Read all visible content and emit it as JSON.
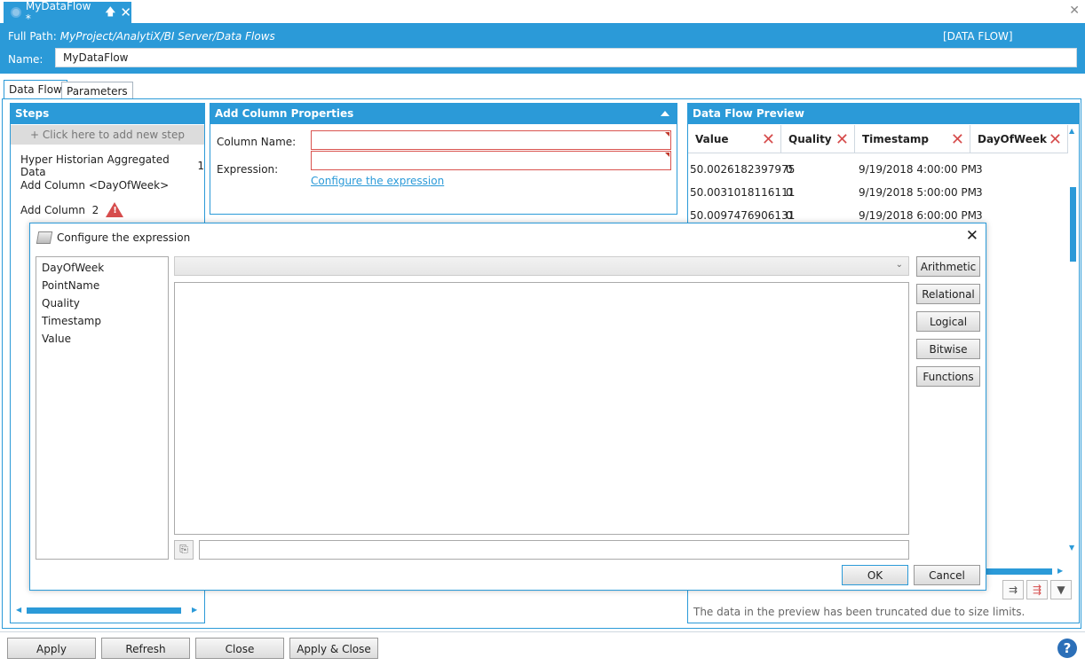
{
  "window": {
    "tab_title": "MyDataFlow *",
    "pin_glyph": "🡅",
    "close_glyph": "✕",
    "window_close_glyph": "✕"
  },
  "header": {
    "fullpath_label": "Full Path:",
    "fullpath_value": "MyProject/AnalytiX/BI Server/Data Flows",
    "type_badge": "[DATA FLOW]",
    "name_label": "Name:",
    "name_value": "MyDataFlow"
  },
  "subtabs": [
    "Data Flow",
    "Parameters"
  ],
  "steps": {
    "title": "Steps",
    "add_step": "+ Click here to add new step",
    "items": [
      {
        "label": "Hyper Historian Aggregated Data",
        "count": "1"
      },
      {
        "label": "Add Column <DayOfWeek>",
        "count": ""
      },
      {
        "label": "Add Column",
        "count": "2"
      }
    ],
    "warning_glyph": "!"
  },
  "properties": {
    "title": "Add Column Properties",
    "column_name_label": "Column Name:",
    "column_name_value": "",
    "expression_label": "Expression:",
    "expression_value": "",
    "configure_link": "Configure the expression"
  },
  "preview": {
    "title": "Data Flow Preview",
    "columns": [
      "Value",
      "Quality",
      "Timestamp",
      "DayOfWeek"
    ],
    "rows": [
      [
        "50.0026182397975",
        "0",
        "9/19/2018 4:00:00 PM",
        "3"
      ],
      [
        "50.0031018116111",
        "0",
        "9/19/2018 5:00:00 PM",
        "3"
      ],
      [
        "50.0097476906131",
        "0",
        "9/19/2018 6:00:00 PM",
        "3"
      ]
    ],
    "truncated_note": "The data in the preview has been truncated due to size limits.",
    "toolbar_icons": [
      "add-column-icon",
      "remove-column-icon",
      "filter-icon"
    ]
  },
  "dialog": {
    "title": "Configure the expression",
    "close_glyph": "✕",
    "columns": [
      "DayOfWeek",
      "PointName",
      "Quality",
      "Timestamp",
      "Value"
    ],
    "combo_value": "",
    "expression_text": "",
    "operator_buttons": [
      "Arithmetic",
      "Relational",
      "Logical",
      "Bitwise",
      "Functions"
    ],
    "ok_label": "OK",
    "cancel_label": "Cancel"
  },
  "bottom": {
    "apply": "Apply",
    "refresh": "Refresh",
    "close": "Close",
    "apply_close": "Apply & Close",
    "help_glyph": "?"
  },
  "colors": {
    "accent": "#2b9ad8",
    "error": "#d64c4c"
  }
}
